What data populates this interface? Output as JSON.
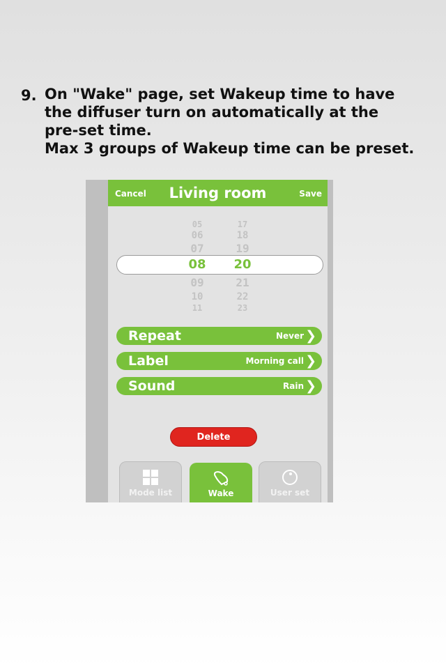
{
  "instruction": {
    "step_number": "9.",
    "lines": [
      "On \"Wake\" page, set Wakeup time to have",
      "the diffuser turn on automatically at the",
      "pre-set time.",
      "Max 3 groups of Wakeup time can be preset."
    ]
  },
  "header": {
    "cancel_label": "Cancel",
    "title": "Living room",
    "save_label": "Save"
  },
  "picker": {
    "hours_above": [
      "05",
      "06",
      "07"
    ],
    "selected_hour": "08",
    "hours_below": [
      "09",
      "10",
      "11"
    ],
    "minutes_above": [
      "17",
      "18",
      "19"
    ],
    "selected_minute": "20",
    "minutes_below": [
      "21",
      "22",
      "23"
    ]
  },
  "settings": [
    {
      "label": "Repeat",
      "value": "Never",
      "icon": "chevron-right-icon"
    },
    {
      "label": "Label",
      "value": "Morning call",
      "icon": "chevron-right-icon"
    },
    {
      "label": "Sound",
      "value": "Rain",
      "icon": "chevron-right-icon"
    }
  ],
  "delete_label": "Delete",
  "tabs": [
    {
      "label": "Mode list",
      "icon": "grid-icon",
      "active": false
    },
    {
      "label": "Wake",
      "icon": "bell-icon",
      "active": true
    },
    {
      "label": "User set",
      "icon": "user-icon",
      "active": false
    }
  ],
  "colors": {
    "accent": "#79c13b",
    "delete": "#e0251f",
    "screen_bg": "#e3e3e3",
    "frame": "#bfbfbf"
  }
}
